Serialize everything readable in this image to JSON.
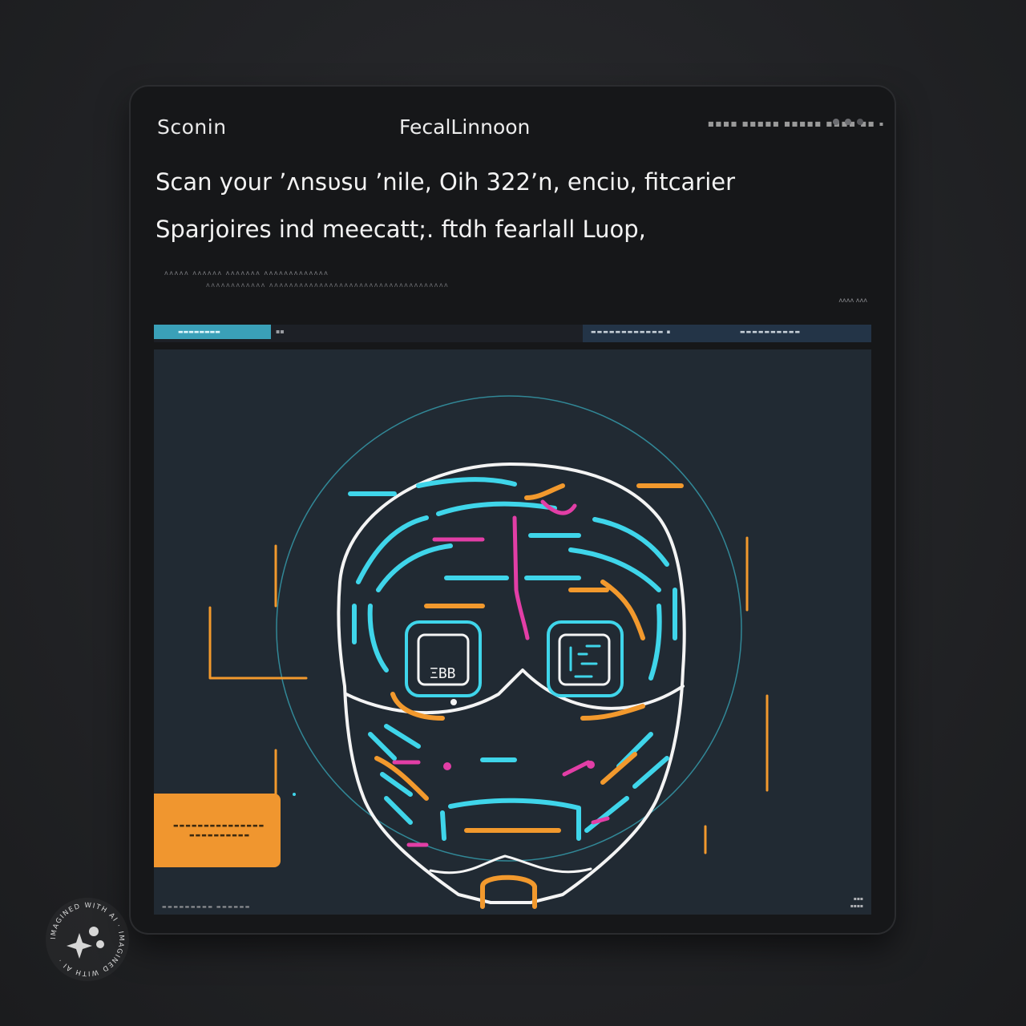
{
  "header": {
    "app_title": "Sconin",
    "center_title": "FecalLinnoon",
    "meta_text": "■■■■ ■■■■■ ■■■■■ ■■■■ ■■ ▪"
  },
  "headline": {
    "line1": "Scan your ʼʌnsʋsu ʼnile,  Oih 322ʼn, enciʋ, fitcarier",
    "line2": "Sparjoires  ind meecatt;.  ftdh fearlall Luop,"
  },
  "fine_print": {
    "line1": "ʌʌʌʌʌ   ʌʌʌʌʌʌ  ʌʌʌʌʌʌʌ ʌʌʌʌʌʌʌʌʌʌʌʌʌ",
    "line2": "ʌʌʌʌʌʌʌʌʌʌʌʌ ʌʌʌʌʌʌʌʌʌʌʌʌʌʌʌʌʌʌʌʌʌʌʌʌʌʌʌʌʌʌʌʌʌʌʌʌ",
    "right": "ʌʌʌʌ ʌʌʌ"
  },
  "tabs": {
    "active": "▬▬▬▬▬▬▬▬",
    "second": "▪▪",
    "right1": "▬▬▬▬▬▬▬▬▬▬▬▬ ▪",
    "right2": "▬▬▬▬▬▬▬▬▬▬"
  },
  "scan": {
    "left_eye_text": "ΞΒΒ",
    "colors": {
      "cyan": "#3fd5ea",
      "orange": "#f2992d",
      "pink": "#e23ea6",
      "white": "#f4f4f4"
    }
  },
  "card": {
    "line1": "▬▬▬▬▬▬▬▬▬▬▬▬▬▬▬",
    "line2": "▬▬▬▬▬▬▬▬▬▬"
  },
  "footer": {
    "left": "▬▬▬▬▬▬▬▬▬  ▬▬▬▬▬▬",
    "right1": "▪▪▪",
    "right2": "▪▪▪▪"
  },
  "badge": {
    "text": "IMAGINED WITH AI · IMAGINED WITH AI ·"
  }
}
